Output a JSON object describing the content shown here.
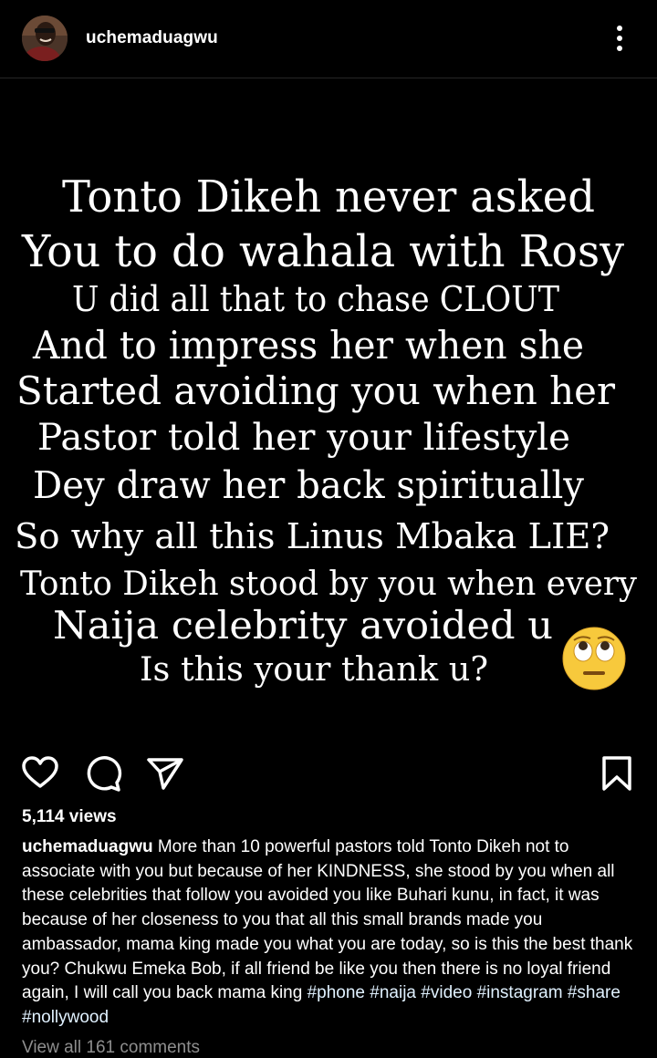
{
  "post": {
    "username": "uchemaduagwu",
    "image_lines": [
      "Tonto Dikeh never asked",
      "You to do wahala with Rosy",
      "U did all that to chase CLOUT",
      "And to impress her when she",
      "Started avoiding you when her",
      "Pastor told her your lifestyle",
      "Dey draw her back spiritually",
      "So why all this Linus Mbaka LIE?",
      "Tonto Dikeh stood by you when every",
      "Naija celebrity avoided u",
      "Is this your thank u?"
    ],
    "emoji": "face-with-rolling-eyes",
    "views": "5,114 views",
    "caption_username": "uchemaduagwu",
    "caption_text": "More than 10 powerful pastors told Tonto Dikeh not to associate with you but because of her KINDNESS, she stood by you when all these celebrities that follow you avoided you like Buhari kunu, in fact, it was because of her closeness to you that all this small brands made you ambassador, mama king made you what you are today, so is this the best thank you? Chukwu Emeka Bob, if all friend be like you then there is no loyal friend again, I will call you back mama king",
    "hashtags": [
      "#phone",
      "#naija",
      "#video",
      "#instagram",
      "#share",
      "#nollywood"
    ],
    "comments_link": "View all 161 comments"
  },
  "icons": {
    "more": "more-vertical-icon",
    "like": "heart-icon",
    "comment": "comment-icon",
    "share": "send-icon",
    "save": "bookmark-icon"
  },
  "colors": {
    "background": "#000000",
    "text": "#ffffff",
    "hashtag": "#e0f1ff",
    "muted": "#8e8e8e",
    "emoji_yellow": "#f7c93c"
  }
}
